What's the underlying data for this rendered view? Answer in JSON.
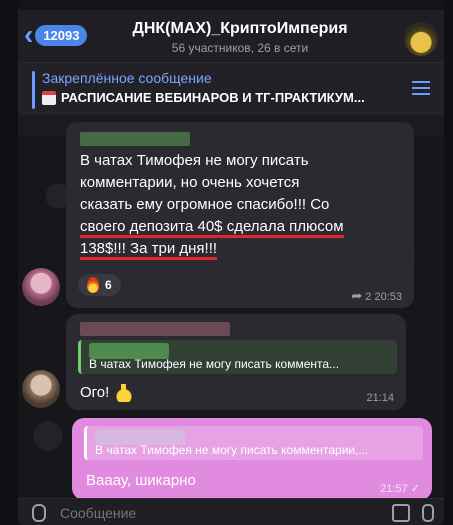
{
  "header": {
    "back_count": "12093",
    "title": "ДНК(MAX)_КриптоИмперия",
    "subtitle": "56 участников, 26 в сети"
  },
  "pinned": {
    "label": "Закреплённое сообщение",
    "text": "РАСПИСАНИЕ ВЕБИНАРОВ И ТГ-ПРАКТИКУМ..."
  },
  "messages": [
    {
      "lines": [
        "В чатах Тимофея не могу писать",
        "комментарии, но очень хочется",
        "сказать ему огромное спасибо!!! Со",
        "своего депозита 40$ сделала плюсом",
        "138$!!! За три дня!!!"
      ],
      "reaction_count": "6",
      "reply_count": "2",
      "time": "20:53"
    },
    {
      "reply_quote": "В чатах Тимофея не могу писать коммента...",
      "text": "Ого!",
      "time": "21:14"
    },
    {
      "reply_quote": "В чатах Тимофея не могу писать комментарии,...",
      "text": "Вааау, шикарно",
      "time": "21:57"
    }
  ],
  "input": {
    "placeholder": "Сообщение"
  },
  "colors": {
    "accent": "#4a86e8",
    "outgoing_bubble": "#e18be0",
    "highlight_underline": "#e0262b"
  }
}
